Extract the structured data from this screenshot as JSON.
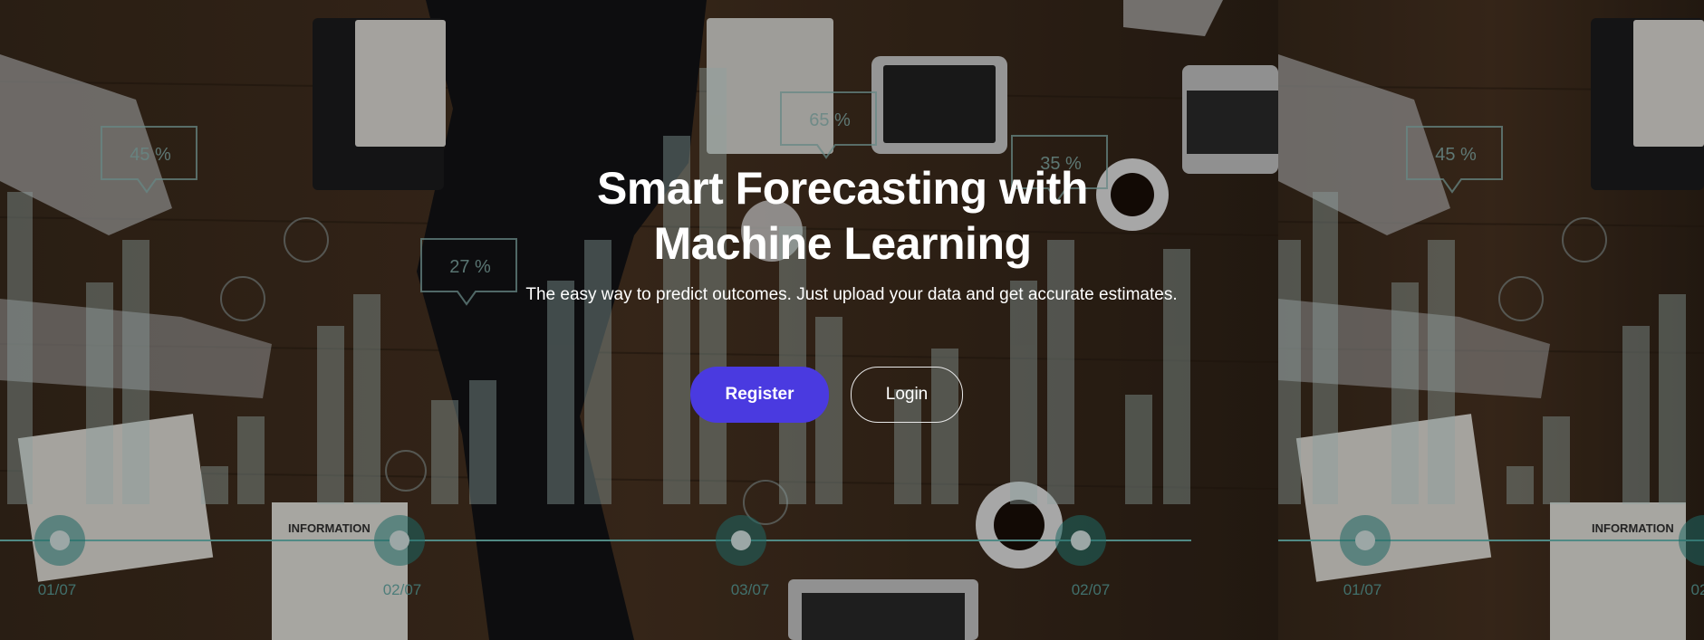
{
  "hero": {
    "title_line1": "Smart Forecasting with",
    "title_line2": "Machine Learning",
    "subtitle": "The easy way to predict outcomes. Just upload your data and get accurate estimates.",
    "register_label": "Register",
    "login_label": "Login"
  },
  "background": {
    "callouts": [
      "45 %",
      "27 %",
      "65 %",
      "35 %",
      "45 %"
    ],
    "dates": [
      "01/07",
      "02/07",
      "03/07",
      "02/07",
      "01/07",
      "02"
    ],
    "document_label": "INFORMATION",
    "document_label_right": "INFORMATION"
  },
  "colors": {
    "accent": "#4a3ae0",
    "overlay_bars": "#a9c9c6",
    "timeline": "#5fb8b2"
  }
}
